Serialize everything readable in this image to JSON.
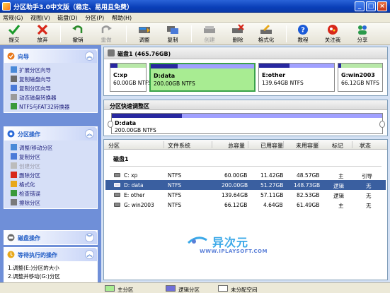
{
  "window": {
    "title": "分区助手3.0中文版（稳定、易用且免费）"
  },
  "menu": [
    "常规(G)",
    "视图(V)",
    "磁盘(D)",
    "分区(P)",
    "帮助(H)"
  ],
  "toolbar": [
    {
      "label": "提交",
      "icon": "check-icon",
      "enabled": true
    },
    {
      "label": "放弃",
      "icon": "x-icon",
      "enabled": true
    },
    {
      "label": "撤销",
      "icon": "undo-icon",
      "enabled": true
    },
    {
      "label": "重做",
      "icon": "redo-icon",
      "enabled": false
    },
    {
      "label": "调整",
      "icon": "resize-icon",
      "enabled": true
    },
    {
      "label": "复制",
      "icon": "copy-icon",
      "enabled": true
    },
    {
      "label": "创建",
      "icon": "create-disk-icon",
      "enabled": false
    },
    {
      "label": "删除",
      "icon": "delete-disk-icon",
      "enabled": true
    },
    {
      "label": "格式化",
      "icon": "format-icon",
      "enabled": true
    },
    {
      "label": "教程",
      "icon": "help-icon",
      "enabled": true
    },
    {
      "label": "关注我",
      "icon": "follow-icon",
      "enabled": true
    },
    {
      "label": "分享",
      "icon": "share-icon",
      "enabled": true
    }
  ],
  "sidebar": {
    "wizard": {
      "title": "向导",
      "items": [
        "扩展分区向导",
        "复制磁盘向导",
        "复制分区向导",
        "动态磁盘转换器",
        "NTFS与FAT32转换器"
      ]
    },
    "partition_ops": {
      "title": "分区操作",
      "items": [
        {
          "label": "调整/移动分区",
          "enabled": true
        },
        {
          "label": "复制分区",
          "enabled": true
        },
        {
          "label": "创建分区",
          "enabled": false
        },
        {
          "label": "删除分区",
          "enabled": true
        },
        {
          "label": "格式化",
          "enabled": true
        },
        {
          "label": "检查错误",
          "enabled": true
        },
        {
          "label": "擦除分区",
          "enabled": true
        }
      ]
    },
    "disk_ops": {
      "title": "磁盘操作"
    },
    "pending": {
      "title": "等待执行的操作",
      "items": [
        "1.调整(E:)分区的大小",
        "2.调整并移动(G:)分区"
      ]
    }
  },
  "disk_map": {
    "disk_label": "磁盘1 (465.76GB)",
    "partitions": [
      {
        "name": "C:xp",
        "size": "60.00GB NTFS",
        "used_fraction": 0.19,
        "selected": false
      },
      {
        "name": "D:data",
        "size": "200.00GB NTFS",
        "used_fraction": 0.26,
        "selected": true
      },
      {
        "name": "E:other",
        "size": "139.64GB NTFS",
        "used_fraction": 0.41,
        "selected": false
      },
      {
        "name": "G:win2003",
        "size": "66.12GB NTFS",
        "used_fraction": 0.07,
        "selected": false
      }
    ]
  },
  "quick_resize": {
    "title": "分区快速调整区",
    "name": "D:data",
    "size": "200.00GB NTFS",
    "used_fraction": 0.26
  },
  "table": {
    "columns": [
      "分区",
      "文件系统",
      "总容量",
      "已用容量",
      "未用容量",
      "标记",
      "状态"
    ],
    "disk_header": "磁盘1",
    "rows": [
      {
        "partition": "C:  xp",
        "fs": "NTFS",
        "total": "60.00GB",
        "used": "11.42GB",
        "free": "48.57GB",
        "flag": "主",
        "status": "引导",
        "selected": false
      },
      {
        "partition": "D:  data",
        "fs": "NTFS",
        "total": "200.00GB",
        "used": "51.27GB",
        "free": "148.73GB",
        "flag": "逻辑",
        "status": "无",
        "selected": true
      },
      {
        "partition": "E:  other",
        "fs": "NTFS",
        "total": "139.64GB",
        "used": "57.11GB",
        "free": "82.53GB",
        "flag": "逻辑",
        "status": "无",
        "selected": false
      },
      {
        "partition": "G:  win2003",
        "fs": "NTFS",
        "total": "66.12GB",
        "used": "4.64GB",
        "free": "61.49GB",
        "flag": "主",
        "status": "无",
        "selected": false
      }
    ]
  },
  "watermark": {
    "big": "异次元",
    "small": "WWW.IPLAYSOFT.COM"
  },
  "legend": [
    {
      "label": "主分区",
      "color": "#a8ec92"
    },
    {
      "label": "逻辑分区",
      "color": "#7070d8"
    },
    {
      "label": "未分配空间",
      "color": "#ffffff"
    }
  ],
  "colors": {
    "selected_partition": "#a8ec92",
    "used_bar": "#2828a0",
    "free_bar": "#a0a0ff",
    "selected_row": "#3a5fa0"
  }
}
